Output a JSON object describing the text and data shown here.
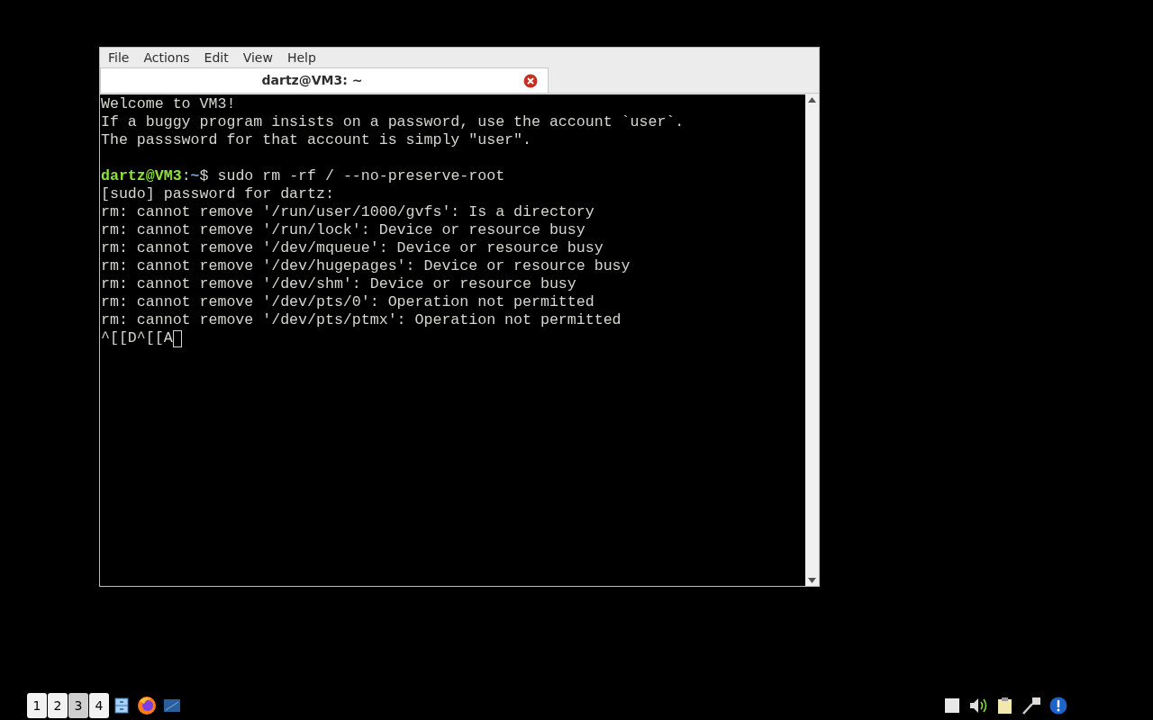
{
  "window": {
    "menu": [
      "File",
      "Actions",
      "Edit",
      "View",
      "Help"
    ],
    "tabs": [
      {
        "title": "dartz@VM3: ~",
        "selected": true
      }
    ],
    "terminal": {
      "lines": [
        {
          "kind": "text",
          "text": "Welcome to VM3!"
        },
        {
          "kind": "text",
          "text": "If a buggy program insists on a password, use the account `user`."
        },
        {
          "kind": "text",
          "text": "The passsword for that account is simply \"user\"."
        },
        {
          "kind": "blank"
        },
        {
          "kind": "prompt",
          "user_host": "dartz@VM3",
          "separator": ":",
          "path": "~",
          "symbol": "$",
          "command": " sudo rm -rf / --no-preserve-root"
        },
        {
          "kind": "text",
          "text": "[sudo] password for dartz:"
        },
        {
          "kind": "text",
          "text": "rm: cannot remove '/run/user/1000/gvfs': Is a directory"
        },
        {
          "kind": "text",
          "text": "rm: cannot remove '/run/lock': Device or resource busy"
        },
        {
          "kind": "text",
          "text": "rm: cannot remove '/dev/mqueue': Device or resource busy"
        },
        {
          "kind": "text",
          "text": "rm: cannot remove '/dev/hugepages': Device or resource busy"
        },
        {
          "kind": "text",
          "text": "rm: cannot remove '/dev/shm': Device or resource busy"
        },
        {
          "kind": "text",
          "text": "rm: cannot remove '/dev/pts/0': Operation not permitted"
        },
        {
          "kind": "text",
          "text": "rm: cannot remove '/dev/pts/ptmx': Operation not permitted"
        },
        {
          "kind": "cursor",
          "text": "^[[D^[[A"
        }
      ]
    }
  },
  "taskbar": {
    "workspaces": [
      {
        "label": "1",
        "selected": false
      },
      {
        "label": "2",
        "selected": false
      },
      {
        "label": "3",
        "selected": true
      },
      {
        "label": "4",
        "selected": false
      }
    ]
  }
}
